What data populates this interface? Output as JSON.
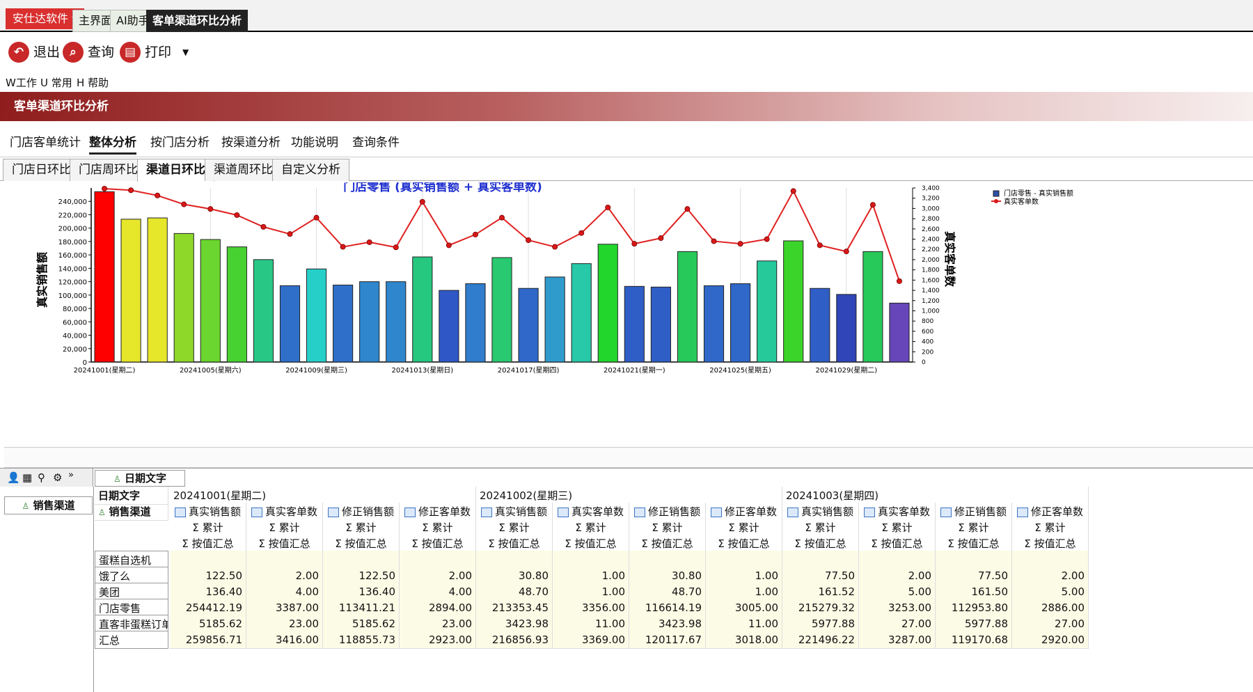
{
  "brand": "安仕达软件",
  "top_tabs": [
    "主界面",
    "AI助手",
    "客单渠道环比分析"
  ],
  "toolbar": {
    "exit": "退出",
    "query": "查询",
    "print": "打印"
  },
  "menu": [
    "W工作",
    "U 常用",
    "H 帮助"
  ],
  "banner": "客单渠道环比分析",
  "tabs_main": [
    "门店客单统计",
    "整体分析",
    "按门店分析",
    "按渠道分析",
    "功能说明",
    "查询条件"
  ],
  "tabs_sub": [
    "门店日环比",
    "门店周环比",
    "渠道日环比",
    "渠道周环比",
    "自定义分析"
  ],
  "chart_data": {
    "type": "bar",
    "title": "门店零售 (真实销售额 + 真实客单数)",
    "ylabel": "真实销售额",
    "y2label": "真实客单数",
    "ylim": [
      0,
      260000
    ],
    "y2lim": [
      0,
      3400
    ],
    "yticks": [
      "240,000",
      "220,000",
      "200,000",
      "180,000",
      "160,000",
      "140,000",
      "120,000",
      "100,000",
      "80,000",
      "60,000",
      "40,000",
      "20,000",
      "0"
    ],
    "y2ticks": [
      "3,400",
      "3,200",
      "3,000",
      "2,800",
      "2,600",
      "2,400",
      "2,200",
      "2,000",
      "1,800",
      "1,600",
      "1,400",
      "1,200",
      "1,000",
      "800",
      "600",
      "400",
      "200",
      "0"
    ],
    "xticks": [
      "20241001(星期二)",
      "20241005(星期六)",
      "20241009(星期三)",
      "20241013(星期日)",
      "20241017(星期四)",
      "20241021(星期一)",
      "20241025(星期五)",
      "20241029(星期二)"
    ],
    "legend": [
      "门店零售 - 真实销售额",
      "真实客单数"
    ],
    "bars": [
      254412.19,
      213353.45,
      215279.32,
      192000,
      183000,
      172000,
      153000,
      114000,
      139000,
      115000,
      120000,
      120000,
      157000,
      107000,
      117000,
      156000,
      110000,
      127000,
      147000,
      176000,
      113000,
      112000,
      165000,
      114000,
      117000,
      151000,
      181000,
      110000,
      101000,
      165000,
      88000
    ],
    "line": [
      3387,
      3356,
      3253,
      3080,
      2990,
      2870,
      2640,
      2500,
      2820,
      2250,
      2340,
      2240,
      3130,
      2280,
      2490,
      2820,
      2380,
      2250,
      2520,
      3020,
      2310,
      2420,
      2990,
      2360,
      2310,
      2400,
      3340,
      2280,
      2160,
      3070,
      1580
    ],
    "colors": [
      "#ff0000",
      "#e6e62b",
      "#e6e62b",
      "#8ed82a",
      "#6bd62f",
      "#48d232",
      "#29c786",
      "#2f6fc9",
      "#27cfc9",
      "#2f6fc9",
      "#2f86cc",
      "#2f86cc",
      "#26c77f",
      "#2f58c6",
      "#2f7dcc",
      "#28c970",
      "#2f68c9",
      "#2f9bcd",
      "#27c9a8",
      "#22d62c",
      "#2f5ec6",
      "#2f5ec6",
      "#27c95a",
      "#2f68c9",
      "#2f68c9",
      "#26c99a",
      "#3bd42a",
      "#2f5ec6",
      "#2f45b8",
      "#27c95a",
      "#6646b8"
    ]
  },
  "grid": {
    "toolbar_header": "日期文字",
    "left_header": "销售渠道",
    "corner_date": "日期文字",
    "corner_channel": "销售渠道",
    "dates": [
      "20241001(星期二)",
      "20241002(星期三)",
      "20241003(星期四)"
    ],
    "measures": [
      "真实销售额",
      "真实客单数",
      "修正销售额",
      "修正客单数"
    ],
    "sum_label": "Σ 累计",
    "agg_label": "Σ 按值汇总",
    "rows": [
      {
        "name": "蛋糕自选机",
        "vals": [
          "",
          "",
          "",
          "",
          "",
          "",
          "",
          "",
          "",
          "",
          "",
          ""
        ]
      },
      {
        "name": "饿了么",
        "vals": [
          "122.50",
          "2.00",
          "122.50",
          "2.00",
          "30.80",
          "1.00",
          "30.80",
          "1.00",
          "77.50",
          "2.00",
          "77.50",
          "2.00"
        ]
      },
      {
        "name": "美团",
        "vals": [
          "136.40",
          "4.00",
          "136.40",
          "4.00",
          "48.70",
          "1.00",
          "48.70",
          "1.00",
          "161.52",
          "5.00",
          "161.50",
          "5.00"
        ]
      },
      {
        "name": "门店零售",
        "vals": [
          "254412.19",
          "3387.00",
          "113411.21",
          "2894.00",
          "213353.45",
          "3356.00",
          "116614.19",
          "3005.00",
          "215279.32",
          "3253.00",
          "112953.80",
          "2886.00"
        ]
      },
      {
        "name": "直客非蛋糕订单",
        "vals": [
          "5185.62",
          "23.00",
          "5185.62",
          "23.00",
          "3423.98",
          "11.00",
          "3423.98",
          "11.00",
          "5977.88",
          "27.00",
          "5977.88",
          "27.00"
        ]
      },
      {
        "name": "汇总",
        "vals": [
          "259856.71",
          "3416.00",
          "118855.73",
          "2923.00",
          "216856.93",
          "3369.00",
          "120117.67",
          "3018.00",
          "221496.22",
          "3287.00",
          "119170.68",
          "2920.00"
        ]
      }
    ]
  }
}
